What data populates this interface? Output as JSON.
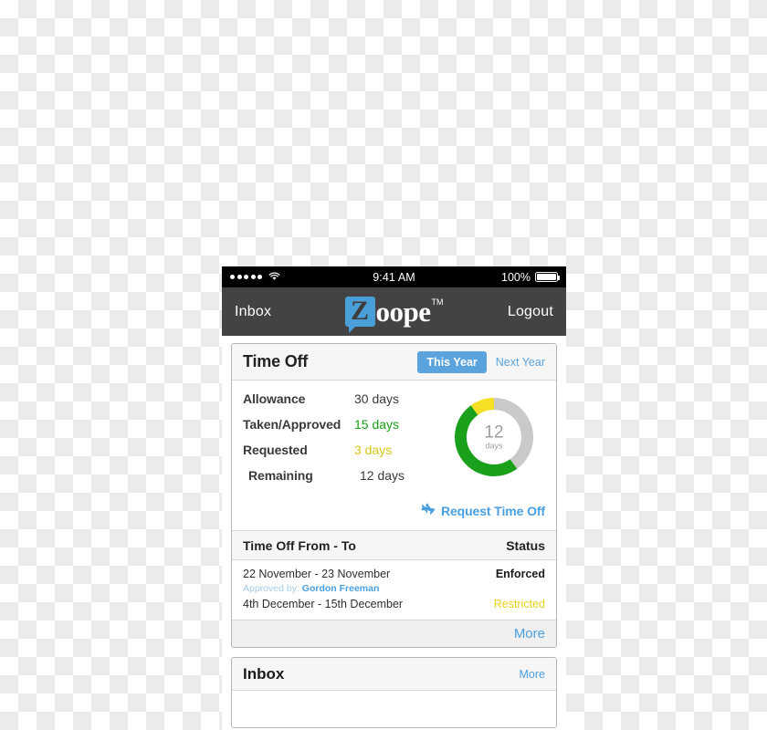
{
  "status_bar": {
    "signal_dots": 5,
    "wifi_icon": "wifi-icon",
    "time": "9:41 AM",
    "battery_percent": "100%",
    "battery_icon": "battery-full-icon"
  },
  "navbar": {
    "left_label": "Inbox",
    "right_label": "Logout",
    "logo": {
      "mark_letter": "Z",
      "word": "oope",
      "trademark": "TM",
      "mark_color": "#4a9fd8"
    }
  },
  "time_off_card": {
    "title": "Time Off",
    "this_year_label": "This Year",
    "next_year_label": "Next Year",
    "stats": [
      {
        "label": "Allowance",
        "value": "30 days",
        "tone": "default"
      },
      {
        "label": "Taken/Approved",
        "value": "15 days",
        "tone": "green"
      },
      {
        "label": "Requested",
        "value": "3 days",
        "tone": "amber"
      },
      {
        "label": "Remaining",
        "value": "12 days",
        "tone": "default"
      }
    ],
    "donut": {
      "number": "12",
      "unit": "days"
    },
    "request_link": {
      "label": "Request Time Off",
      "icon": "airplane-icon"
    }
  },
  "time_off_table": {
    "col_dates": "Time Off From - To",
    "col_status": "Status",
    "rows": [
      {
        "dates": "22 November - 23 November",
        "status": "Enforced",
        "status_tone": "enforced",
        "approved_label": "Approved by:",
        "approved_name": "Gordon Freeman"
      },
      {
        "dates": "4th December - 15th December",
        "status": "Restricted",
        "status_tone": "restricted"
      }
    ],
    "more_label": "More"
  },
  "inbox_card": {
    "title": "Inbox",
    "more_label": "More"
  },
  "chart_data": {
    "type": "pie",
    "title": "Time Off allowance breakdown",
    "categories": [
      "Taken/Approved",
      "Requested",
      "Remaining"
    ],
    "values": [
      15,
      3,
      12
    ],
    "unit": "days",
    "total": 30,
    "colors": [
      "#1aa01a",
      "#f5e026",
      "#c9c9c9"
    ],
    "center_label": "12 days",
    "donut": true,
    "start_angle_deg": 0,
    "direction": "clockwise",
    "legend": "none"
  },
  "colors": {
    "accent_blue": "#4a9fe0",
    "button_blue": "#5ba3dd",
    "green": "#199b19",
    "amber": "#d9c516",
    "navbar": "#434343",
    "donut_gray": "#c9c9c9"
  }
}
